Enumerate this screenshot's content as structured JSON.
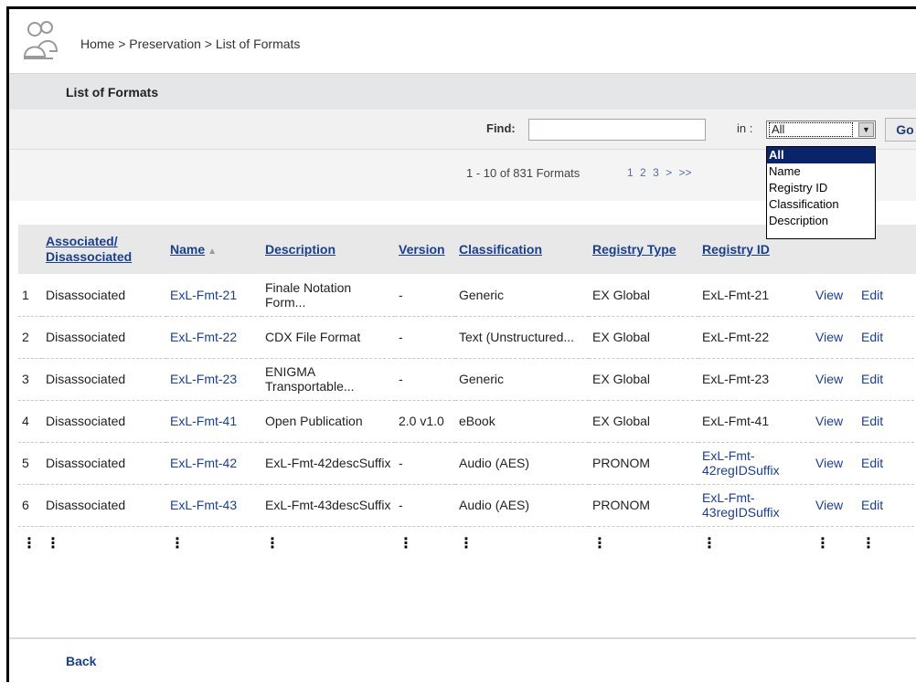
{
  "breadcrumb": "Home > Preservation > List of Formats",
  "page_title": "List of Formats",
  "find": {
    "label": "Find:",
    "value": "",
    "in_label": "in :",
    "selected": "All",
    "go_label": "Go"
  },
  "dropdown_options": [
    "All",
    "Name",
    "Registry ID",
    "Classification",
    "Description"
  ],
  "pager": {
    "count": "1 - 10 of 831 Formats",
    "pages": [
      "1",
      "2",
      "3",
      ">",
      ">>"
    ]
  },
  "columns": [
    "Associated/ Disassociated",
    "Name",
    "Description",
    "Version",
    "Classification",
    "Registry Type",
    "Registry ID"
  ],
  "rows": [
    {
      "n": "1",
      "assoc": "Disassociated",
      "name": "ExL-Fmt-21",
      "desc": "Finale Notation Form...",
      "version": "-",
      "class": "Generic",
      "rtype": "EX Global",
      "rid": "ExL-Fmt-21",
      "view": "View",
      "edit": "Edit"
    },
    {
      "n": "2",
      "assoc": "Disassociated",
      "name": "ExL-Fmt-22",
      "desc": "CDX File Format",
      "version": "-",
      "class": "Text (Unstructured...",
      "rtype": "EX Global",
      "rid": "ExL-Fmt-22",
      "view": "View",
      "edit": "Edit"
    },
    {
      "n": "3",
      "assoc": "Disassociated",
      "name": "ExL-Fmt-23",
      "desc": "ENIGMA Transportable...",
      "version": "-",
      "class": "Generic",
      "rtype": "EX Global",
      "rid": "ExL-Fmt-23",
      "view": "View",
      "edit": "Edit"
    },
    {
      "n": "4",
      "assoc": "Disassociated",
      "name": "ExL-Fmt-41",
      "desc": "Open Publication",
      "version": "2.0 v1.0",
      "class": "eBook",
      "rtype": "EX Global",
      "rid": "ExL-Fmt-41",
      "view": "View",
      "edit": "Edit"
    },
    {
      "n": "5",
      "assoc": "Disassociated",
      "name": "ExL-Fmt-42",
      "desc": "ExL-Fmt-42descSuffix",
      "version": "-",
      "class": "Audio (AES)",
      "rtype": "PRONOM",
      "rid": "ExL-Fmt-42regIDSuffix",
      "view": "View",
      "edit": "Edit"
    },
    {
      "n": "6",
      "assoc": "Disassociated",
      "name": "ExL-Fmt-43",
      "desc": "ExL-Fmt-43descSuffix",
      "version": "-",
      "class": "Audio (AES)",
      "rtype": "PRONOM",
      "rid": "ExL-Fmt-43regIDSuffix",
      "view": "View",
      "edit": "Edit"
    }
  ],
  "ellipsis": "⋮",
  "back_label": "Back"
}
